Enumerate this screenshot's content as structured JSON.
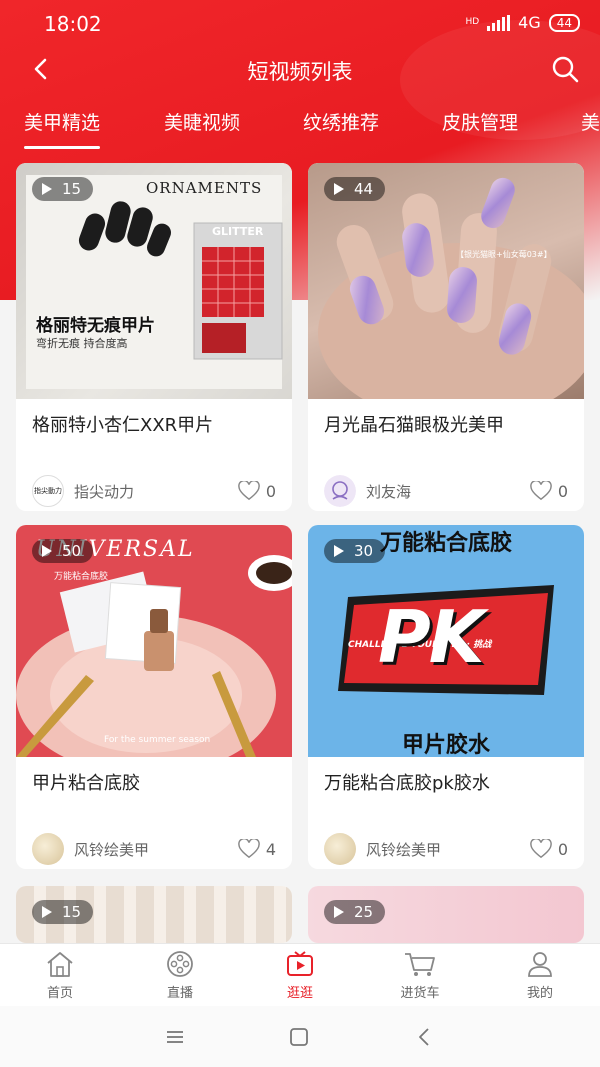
{
  "status_bar": {
    "time": "18:02",
    "network": "4G",
    "battery": "44"
  },
  "nav": {
    "title": "短视频列表"
  },
  "tabs": [
    {
      "label": "美甲精选"
    },
    {
      "label": "美睫视频"
    },
    {
      "label": "纹绣推荐"
    },
    {
      "label": "皮肤管理"
    },
    {
      "label": "美"
    }
  ],
  "cards": [
    {
      "views": "15",
      "thumb_text": {
        "brand": "ORNAMENTS",
        "box": "GLITTER",
        "caption": "格丽特无痕甲片",
        "sub": "弯折无痕 持合度高"
      },
      "title": "格丽特小杏仁XXR甲片",
      "author": "指尖动力",
      "avatar_text": "指尖動力",
      "likes": "0"
    },
    {
      "views": "44",
      "thumb_text": {
        "tag": "【银光猫眼+仙女莓03#】"
      },
      "title": "月光晶石猫眼极光美甲",
      "author": "刘友海",
      "likes": "0"
    },
    {
      "views": "50",
      "thumb_text": {
        "brand": "UNIVERSAL",
        "sub": "万能粘合底胶",
        "season": "For the summer season"
      },
      "title": "甲片粘合底胶",
      "author": "风铃绘美甲",
      "likes": "4"
    },
    {
      "views": "30",
      "thumb_text": {
        "top": "万能粘合底胶",
        "challenge": "CHALLENGE YOURSELF · 挑战",
        "pk": "PK",
        "bottom": "甲片胶水"
      },
      "title": "万能粘合底胶pk胶水",
      "author": "风铃绘美甲",
      "likes": "0"
    },
    {
      "views": "15"
    },
    {
      "views": "25"
    }
  ],
  "bottom_nav": [
    {
      "label": "首页",
      "icon": "home-icon"
    },
    {
      "label": "直播",
      "icon": "film-reel-icon"
    },
    {
      "label": "逛逛",
      "icon": "video-play-icon"
    },
    {
      "label": "进货车",
      "icon": "cart-icon"
    },
    {
      "label": "我的",
      "icon": "user-icon"
    }
  ],
  "colors": {
    "brand_red": "#e8222a",
    "text": "#222222",
    "muted": "#666666"
  }
}
